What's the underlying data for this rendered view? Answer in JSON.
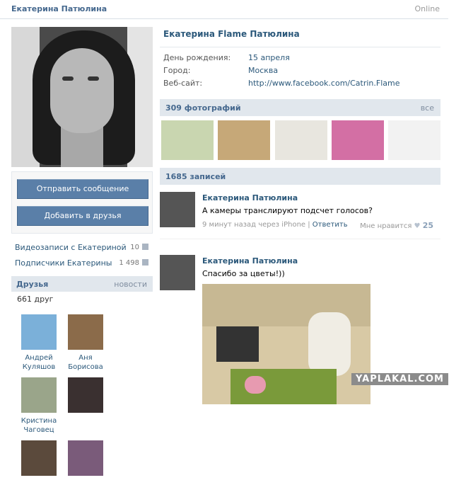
{
  "header": {
    "name": "Екатерина Патюлина",
    "status": "Online"
  },
  "profile": {
    "full_name": "Екатерина Flame Патюлина",
    "info": [
      {
        "label": "День рождения:",
        "value": "15 апреля"
      },
      {
        "label": "Город:",
        "value": "Москва"
      },
      {
        "label": "Веб-сайт:",
        "value": "http://www.facebook.com/Catrin.Flame"
      }
    ]
  },
  "actions": {
    "message": "Отправить сообщение",
    "add_friend": "Добавить в друзья"
  },
  "side_links": [
    {
      "label": "Видеозаписи с Екатериной",
      "count": "10"
    },
    {
      "label": "Подписчики Екатерины",
      "count": "1 498"
    }
  ],
  "friends": {
    "title": "Друзья",
    "more": "новости",
    "count_text": "661 друг",
    "items": [
      {
        "first": "Андрей",
        "last": "Куляшов"
      },
      {
        "first": "Аня",
        "last": "Борисова"
      },
      {
        "first": "Кристина",
        "last": "Чаговец"
      }
    ]
  },
  "photos": {
    "title": "309 фотографий",
    "all": "все"
  },
  "wall": {
    "title": "1685 записей",
    "posts": [
      {
        "author": "Екатерина Патюлина",
        "text": "А камеры транслируют подсчет голосов?",
        "time": "9 минут назад через iPhone",
        "reply": "Ответить",
        "like_label": "Мне нравится",
        "likes": "25"
      },
      {
        "author": "Екатерина Патюлина",
        "text": "Спасибо за цветы!))"
      }
    ]
  },
  "watermark": "YAPLAKAL.COM",
  "colors": {
    "link": "#2b587a",
    "header_bg": "#e1e7ed",
    "button": "#5a7fa8"
  }
}
